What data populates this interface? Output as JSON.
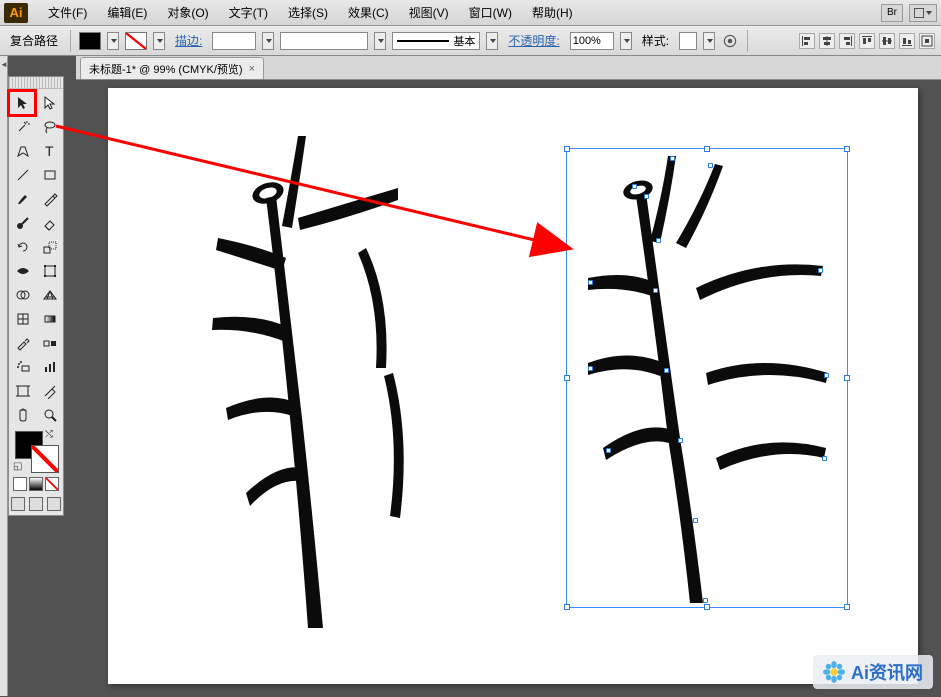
{
  "app": {
    "logo": "Ai"
  },
  "menu": {
    "file": "文件(F)",
    "edit": "编辑(E)",
    "object": "对象(O)",
    "type": "文字(T)",
    "select": "选择(S)",
    "effect": "效果(C)",
    "view": "视图(V)",
    "window": "窗口(W)",
    "help": "帮助(H)",
    "bridge": "Br"
  },
  "control": {
    "selection_type": "复合路径",
    "stroke_label": "描边:",
    "brush_label": "基本",
    "opacity_label": "不透明度:",
    "opacity_value": "100%",
    "style_label": "样式:"
  },
  "tabs": {
    "doc1": "未标题-1* @ 99% (CMYK/预览)"
  },
  "tools": {
    "selection": "selection-tool",
    "direct": "direct-selection-tool",
    "wand": "magic-wand-tool",
    "lasso": "lasso-tool",
    "pen": "pen-tool",
    "type": "type-tool",
    "line": "line-tool",
    "rect": "rectangle-tool",
    "brush": "paintbrush-tool",
    "pencil": "pencil-tool",
    "blob": "blob-brush-tool",
    "eraser": "eraser-tool",
    "rotate": "rotate-tool",
    "scale": "scale-tool",
    "width": "width-tool",
    "free": "free-transform-tool",
    "shape": "shape-builder",
    "perspective": "perspective-grid",
    "mesh": "mesh-tool",
    "gradient": "gradient-tool",
    "eyedrop": "eyedropper-tool",
    "blend": "blend-tool",
    "symbol": "symbol-sprayer",
    "graph": "column-graph-tool",
    "artboard": "artboard-tool",
    "slice": "slice-tool",
    "hand": "hand-tool",
    "zoom": "zoom-tool"
  },
  "watermark": {
    "text": "Ai资讯网"
  }
}
